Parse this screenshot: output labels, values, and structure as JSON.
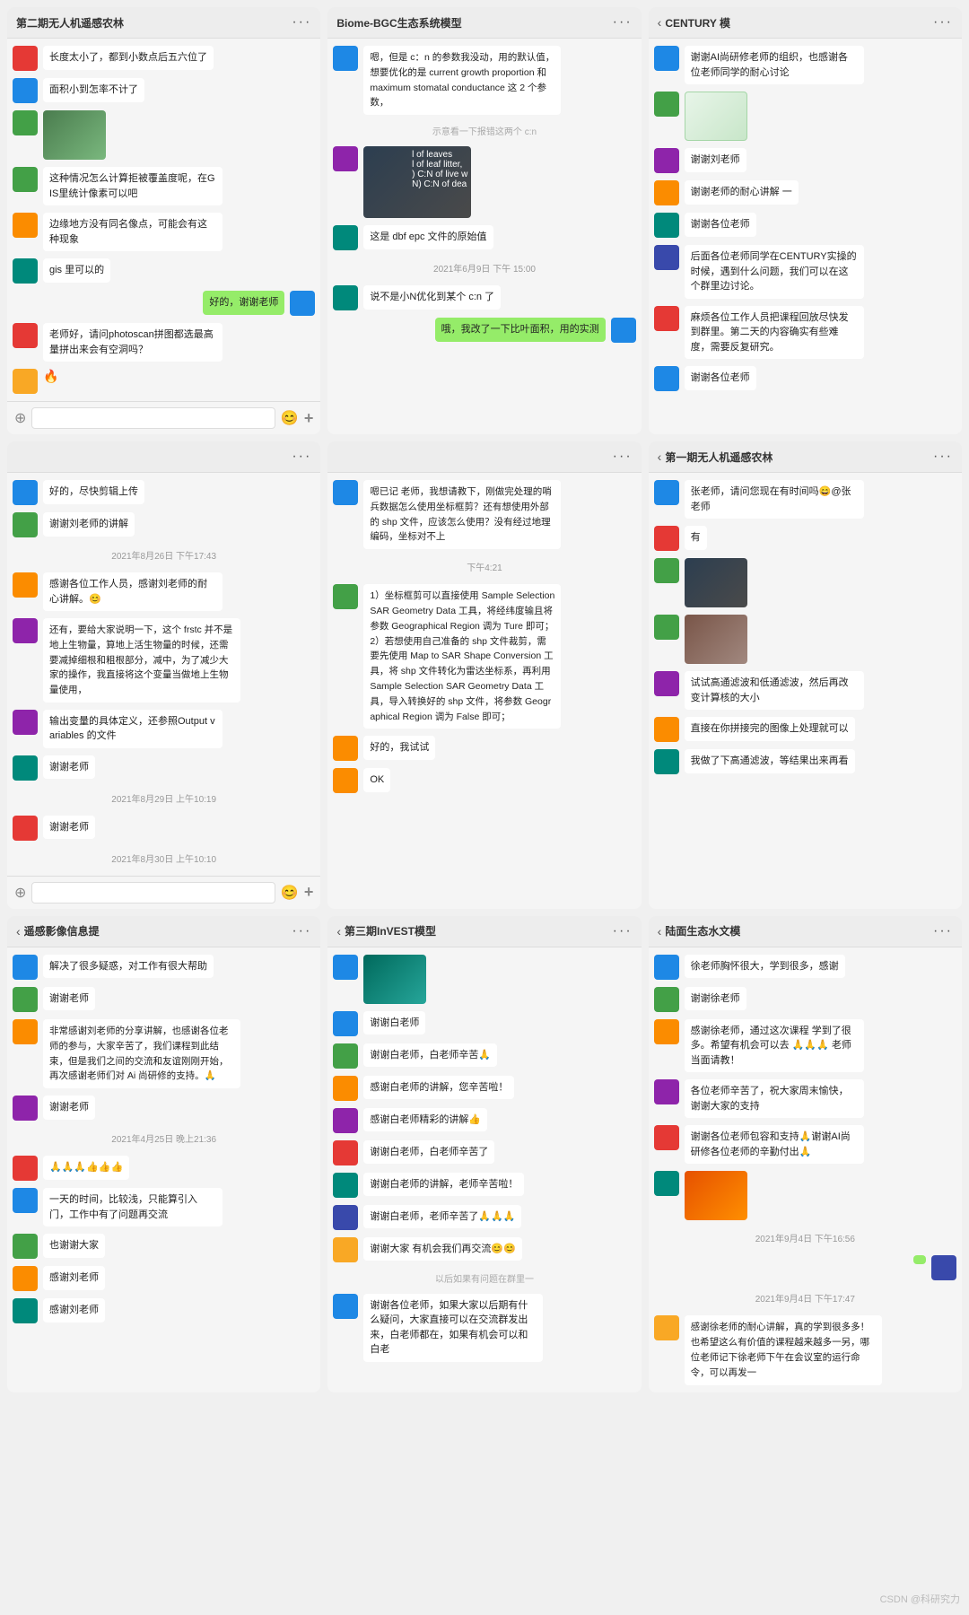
{
  "panels": [
    {
      "id": "panel1",
      "title": "第二期无人机遥感农林",
      "hasBack": false,
      "messages": [
        {
          "type": "msg",
          "align": "left",
          "avatarColor": "red",
          "text": "长度太小了，都到小数点后五六位了"
        },
        {
          "type": "msg",
          "align": "left",
          "avatarColor": "blue",
          "text": "面积小到怎率不计了"
        },
        {
          "type": "img",
          "align": "left",
          "avatarColor": "green",
          "imgType": "green-img"
        },
        {
          "type": "msg",
          "align": "left",
          "avatarColor": "green",
          "text": "这种情况怎么计算拒被覆盖度呢，在GIS里统计像素可以吧"
        },
        {
          "type": "msg",
          "align": "left",
          "avatarColor": "orange",
          "text": "边缘地方没有同名像点，可能会有这种现象"
        },
        {
          "type": "msg",
          "align": "left",
          "avatarColor": "teal",
          "text": "gis 里可以的"
        },
        {
          "type": "msg",
          "align": "right",
          "avatarColor": "blue",
          "text": "好的，谢谢老师"
        },
        {
          "type": "msg",
          "align": "left",
          "avatarColor": "red",
          "text": "老师好，请问photoscan拼图都选最高量拼出来会有空洞吗？"
        },
        {
          "type": "flame",
          "align": "left",
          "avatarColor": "yellow"
        }
      ],
      "hasFooter": true
    },
    {
      "id": "panel2",
      "title": "Biome-BGC生态系统模型",
      "hasBack": false,
      "messages": [
        {
          "type": "msg",
          "align": "left",
          "avatarColor": "blue",
          "text": "嗯，但是 c：n 的参数我没动，用的默认值，想要优化的是 current growth proportion 和 maximum stomatal conductance 这 2 个参数，"
        },
        {
          "type": "system",
          "text": "示意看一下报错这两个 c:n"
        },
        {
          "type": "imgtext",
          "align": "left",
          "avatarColor": "purple",
          "imgType": "dark-img",
          "text": "l of leaves\nl of leaf litter,\n) C:N of live w\nN) C:N of dea"
        },
        {
          "type": "msg",
          "align": "left",
          "avatarColor": "teal",
          "text": "这是 dbf epc 文件的原始值"
        },
        {
          "type": "timestamp",
          "text": "2021年6月9日 下午 15:00"
        },
        {
          "type": "msg",
          "align": "left",
          "avatarColor": "teal",
          "text": "说不是小N优化到某个 c:n 了"
        },
        {
          "type": "msg",
          "align": "right",
          "avatarColor": "blue",
          "text": "哦，我改了一下比叶面积，用的实测"
        }
      ],
      "hasFooter": false
    },
    {
      "id": "panel3",
      "title": "CENTURY 模",
      "hasBack": true,
      "messages": [
        {
          "type": "msg",
          "align": "left",
          "avatarColor": "blue",
          "text": "谢谢AI尚研修老师的组织，也感谢各位老师同学的耐心讨论"
        },
        {
          "type": "img",
          "align": "left",
          "avatarColor": "green",
          "imgType": "map-img"
        },
        {
          "type": "msg",
          "align": "left",
          "avatarColor": "purple",
          "text": "谢谢刘老师"
        },
        {
          "type": "msg",
          "align": "left",
          "avatarColor": "orange",
          "text": "谢谢老师的耐心讲解 一"
        },
        {
          "type": "msg",
          "align": "left",
          "avatarColor": "teal",
          "text": "谢谢各位老师"
        },
        {
          "type": "msg",
          "align": "left",
          "avatarColor": "indigo",
          "text": "后面各位老师同学在CENTURY实操的时候，遇到什么问题，我们可以在这个群里边讨论。"
        },
        {
          "type": "msg",
          "align": "left",
          "avatarColor": "red",
          "text": "麻烦各位工作人员把课程回放尽快发到群里。第二天的内容确实有些难度，需要反复研究。"
        },
        {
          "type": "msg",
          "align": "left",
          "avatarColor": "blue",
          "text": "谢谢各位老师"
        }
      ],
      "hasFooter": false
    },
    {
      "id": "panel4",
      "title": "",
      "hasBack": false,
      "messages": [
        {
          "type": "msg",
          "align": "left",
          "avatarColor": "blue",
          "text": "好的，尽快剪辑上传"
        },
        {
          "type": "msg",
          "align": "left",
          "avatarColor": "green",
          "text": "谢谢刘老师的讲解"
        },
        {
          "type": "timestamp",
          "text": "2021年8月26日 下午17:43"
        },
        {
          "type": "msg",
          "align": "left",
          "avatarColor": "orange",
          "text": "感谢各位工作人员，感谢刘老师的耐心讲解。😊"
        },
        {
          "type": "msg",
          "align": "left",
          "avatarColor": "purple",
          "text": "还有，要给大家说明一下，这个 frstc 并不是地上生物量，算地上活生物量的时候，还需要减掉细根和粗根部分，减中，为了减少大家的操作，我直接将这个变量当做地上生物量使用，"
        },
        {
          "type": "msg",
          "align": "left",
          "avatarColor": "purple",
          "text": "输出变量的具体定义，还参照Output variables 的文件"
        },
        {
          "type": "msg",
          "align": "left",
          "avatarColor": "teal",
          "text": "谢谢老师"
        },
        {
          "type": "timestamp",
          "text": "2021年8月29日 上午10:19"
        },
        {
          "type": "msg",
          "align": "left",
          "avatarColor": "red",
          "text": "谢谢老师"
        },
        {
          "type": "timestamp",
          "text": "2021年8月30日 上午10:10"
        }
      ],
      "hasFooter": true
    },
    {
      "id": "panel5",
      "title": "",
      "hasBack": false,
      "messages": [
        {
          "type": "msg",
          "align": "left",
          "avatarColor": "blue",
          "text": "嗯已记 老师，我想请教下，刚做完处理的哨兵数据怎么使用坐标框剪？还有想使用外部的 shp 文件，应该怎么使用？没有经过地理编码，坐标对不上"
        },
        {
          "type": "timestamp",
          "text": "下午4:21"
        },
        {
          "type": "msg",
          "align": "left",
          "avatarColor": "green",
          "text": "1）坐标框剪可以直接使用 Sample Selection SAR Geometry Data 工具，将经纬度输且将参数 Geographical Region 调为 Ture 即可；\n2）若想使用自己准备的 shp 文件裁剪，需要先使用 Map to SAR Shape Conversion 工具，将 shp 文件转化为雷达坐标系，再利用 Sample Selection SAR Geometry Data 工具，导入转换好的 shp 文件，将参数 Geographical Region 调为 False 即可；"
        },
        {
          "type": "msg",
          "align": "left",
          "avatarColor": "orange",
          "text": "好的，我试试"
        },
        {
          "type": "msg",
          "align": "left",
          "avatarColor": "orange",
          "text": "OK"
        }
      ],
      "hasFooter": false
    },
    {
      "id": "panel6",
      "title": "第一期无人机遥感农林",
      "hasBack": true,
      "messages": [
        {
          "type": "msg",
          "align": "left",
          "avatarColor": "blue",
          "text": "张老师，请问您现在有时间吗😄@张老师"
        },
        {
          "type": "msg",
          "align": "left",
          "avatarColor": "red",
          "text": "有"
        },
        {
          "type": "img",
          "align": "left",
          "avatarColor": "green",
          "imgType": "dark-img"
        },
        {
          "type": "img",
          "align": "left",
          "avatarColor": "green",
          "imgType": "brown-img"
        },
        {
          "type": "msg",
          "align": "left",
          "avatarColor": "purple",
          "text": "试试高通滤波和低通滤波，然后再改变计算核的大小"
        },
        {
          "type": "msg",
          "align": "left",
          "avatarColor": "orange",
          "text": "直接在你拼接完的图像上处理就可以"
        },
        {
          "type": "msg",
          "align": "left",
          "avatarColor": "teal",
          "text": "我做了下高通滤波，等结果出来再看"
        }
      ],
      "hasFooter": false
    },
    {
      "id": "panel7",
      "title": "遥感影像信息提",
      "hasBack": true,
      "messages": [
        {
          "type": "msg",
          "align": "left",
          "avatarColor": "blue",
          "text": "解决了很多疑惑，对工作有很大帮助"
        },
        {
          "type": "msg",
          "align": "left",
          "avatarColor": "green",
          "text": "谢谢老师"
        },
        {
          "type": "msg",
          "align": "left",
          "avatarColor": "orange",
          "text": "非常感谢刘老师的分享讲解，也感谢各位老师的参与，大家辛苦了，我们课程到此结束，但是我们之间的交流和友谊刚刚开始，再次感谢老师们对 Ai 尚研修的支持。🙏"
        },
        {
          "type": "msg",
          "align": "left",
          "avatarColor": "purple",
          "text": "谢谢老师"
        },
        {
          "type": "timestamp",
          "text": "2021年4月25日 晚上21:36"
        },
        {
          "type": "msg",
          "align": "left",
          "avatarColor": "red",
          "text": "🙏🙏🙏👍👍👍"
        },
        {
          "type": "msg",
          "align": "left",
          "avatarColor": "blue",
          "text": "一天的时间，比较浅，只能算引入门，工作中有了问题再交流"
        },
        {
          "type": "msg",
          "align": "left",
          "avatarColor": "green",
          "text": "也谢谢大家"
        },
        {
          "type": "msg",
          "align": "left",
          "avatarColor": "orange",
          "text": "感谢刘老师"
        },
        {
          "type": "msg",
          "align": "left",
          "avatarColor": "teal",
          "text": "感谢刘老师"
        }
      ],
      "hasFooter": false
    },
    {
      "id": "panel8",
      "title": "第三期InVEST模型",
      "hasBack": true,
      "messages": [
        {
          "type": "img",
          "align": "left",
          "avatarColor": "blue",
          "imgType": "teal-img"
        },
        {
          "type": "msg",
          "align": "left",
          "avatarColor": "blue",
          "text": "谢谢白老师"
        },
        {
          "type": "msg",
          "align": "left",
          "avatarColor": "green",
          "text": "谢谢白老师，白老师辛苦🙏"
        },
        {
          "type": "msg",
          "align": "left",
          "avatarColor": "orange",
          "text": "感谢白老师的讲解，您辛苦啦！"
        },
        {
          "type": "msg",
          "align": "left",
          "avatarColor": "purple",
          "text": "感谢白老师精彩的讲解👍"
        },
        {
          "type": "msg",
          "align": "left",
          "avatarColor": "red",
          "text": "谢谢白老师，白老师辛苦了"
        },
        {
          "type": "msg",
          "align": "left",
          "avatarColor": "teal",
          "text": "谢谢白老师的讲解，老师辛苦啦！"
        },
        {
          "type": "msg",
          "align": "left",
          "avatarColor": "indigo",
          "text": "谢谢白老师，老师辛苦了🙏🙏🙏"
        },
        {
          "type": "msg",
          "align": "left",
          "avatarColor": "yellow",
          "text": "谢谢大家 有机会我们再交流😊😊"
        },
        {
          "type": "system",
          "text": "以后如果有问题在群里一"
        },
        {
          "type": "msg",
          "align": "left",
          "avatarColor": "blue",
          "text": "谢谢各位老师，如果大家以后期有什么疑问，大家直接可以在交流群发出来，白老师都在，如果有机会可以和白老"
        }
      ],
      "hasFooter": false
    },
    {
      "id": "panel9",
      "title": "陆面生态水文模",
      "hasBack": true,
      "messages": [
        {
          "type": "msg",
          "align": "left",
          "avatarColor": "blue",
          "text": "徐老师胸怀很大，学到很多，感谢"
        },
        {
          "type": "msg",
          "align": "left",
          "avatarColor": "green",
          "text": "谢谢徐老师"
        },
        {
          "type": "msg",
          "align": "left",
          "avatarColor": "orange",
          "text": "感谢徐老师，通过这次课程  学到了很多。希望有机会可以去 🙏🙏🙏 老师当面请教！"
        },
        {
          "type": "msg",
          "align": "left",
          "avatarColor": "purple",
          "text": "各位老师辛苦了，祝大家周末愉快，谢谢大家的支持"
        },
        {
          "type": "msg",
          "align": "left",
          "avatarColor": "red",
          "text": "谢谢各位老师包容和支持🙏谢谢AI尚研修各位老师的辛勤付出🙏"
        },
        {
          "type": "img",
          "align": "left",
          "avatarColor": "teal",
          "imgType": "orange-img"
        },
        {
          "type": "timestamp",
          "text": "2021年9月4日 下午16:56"
        },
        {
          "type": "msg",
          "align": "right",
          "avatarColor": "indigo",
          "text": ""
        },
        {
          "type": "timestamp",
          "text": "2021年9月4日 下午17:47"
        },
        {
          "type": "msg",
          "align": "left",
          "avatarColor": "yellow",
          "text": "感谢徐老师的耐心讲解，真的学到很多多！也希望这么有价值的课程越来越多一另，哪位老师记下徐老师下午在会议室的运行命令，可以再发一"
        }
      ],
      "hasFooter": false
    }
  ],
  "watermark": "CSDN @科研究力"
}
